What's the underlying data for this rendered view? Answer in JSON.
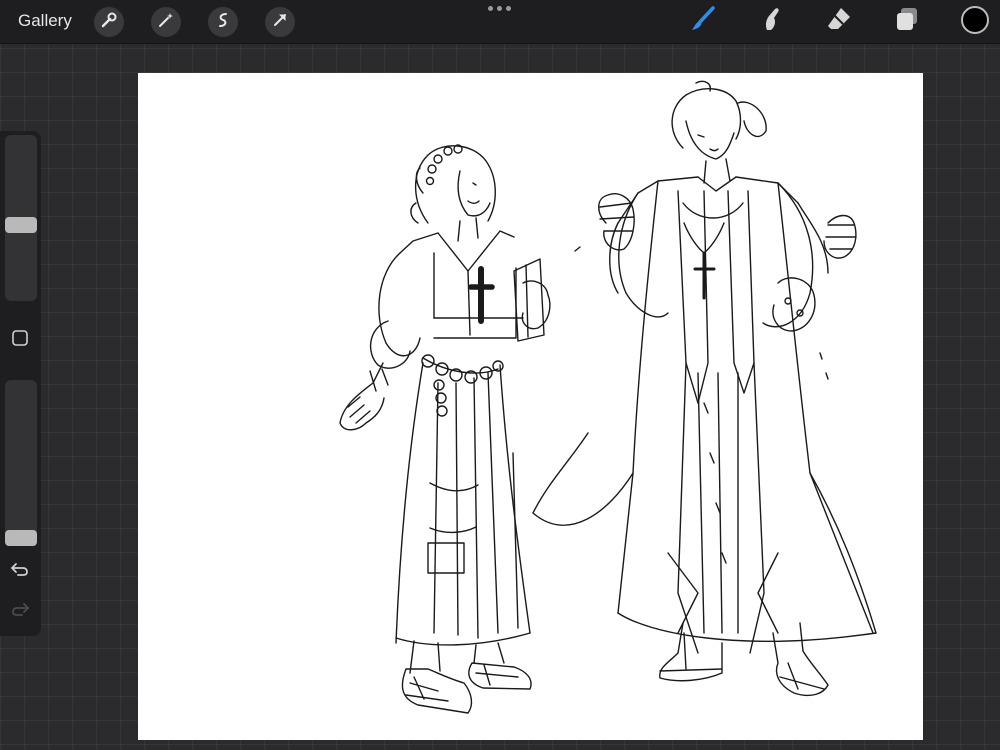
{
  "app": {
    "gallery_label": "Gallery"
  },
  "toolbar": {
    "left_tools": [
      "wrench-icon",
      "magic-wand-icon",
      "selection-icon",
      "transform-arrow-icon"
    ],
    "right_tools": [
      "brush-icon",
      "smudge-icon",
      "eraser-icon",
      "layers-icon"
    ],
    "active_tool": "brush",
    "active_color": "#000000",
    "accent": "#2f8fe8"
  },
  "sidebar": {
    "brush_size": 0.55,
    "opacity": 1.0
  }
}
